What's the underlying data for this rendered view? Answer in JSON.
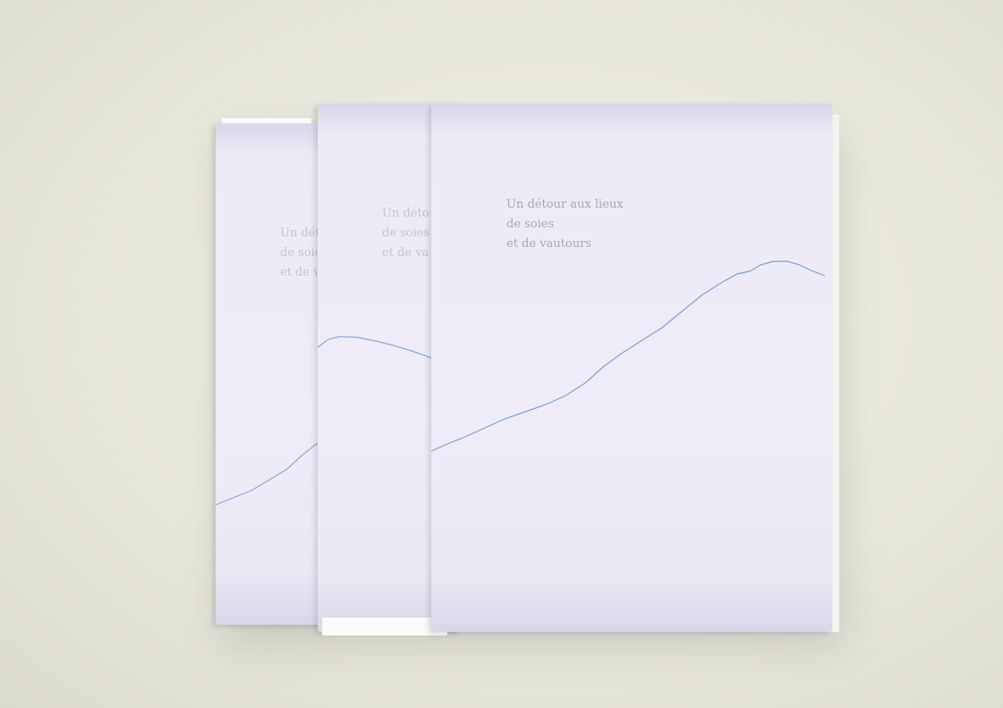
{
  "scene": {
    "subject": "three-books-with-translucent-jackets",
    "background_color": "#e9e8dc",
    "jacket_color": "#eeedf7",
    "line_color": "#7f9fd0"
  },
  "books": [
    {
      "cover_line_1": "Un dét",
      "cover_line_2": "de soie",
      "cover_line_3": "et de va"
    },
    {
      "cover_line_1": "Un déto",
      "cover_line_2": "de soies",
      "cover_line_3": "et de va"
    },
    {
      "cover_line_1": "Un détour aux lieux",
      "cover_line_2": "de soies",
      "cover_line_3": "et de vautours"
    }
  ]
}
